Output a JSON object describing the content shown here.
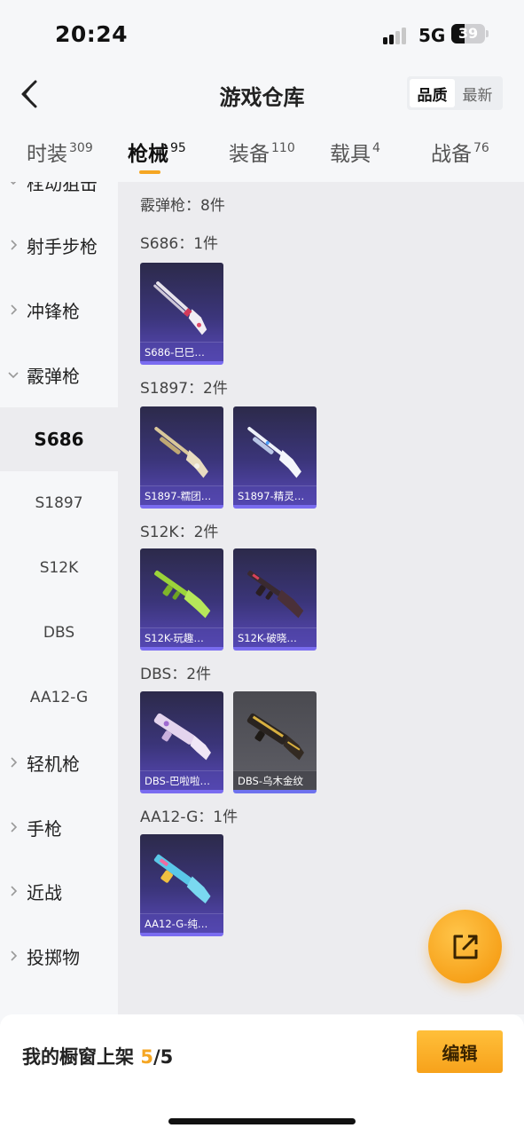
{
  "status_bar": {
    "time": "20:24",
    "network": "5G",
    "battery": "39",
    "battery_level": 0.39
  },
  "header": {
    "title": "游戏仓库",
    "sort_options": [
      "品质",
      "最新"
    ],
    "active_sort": "品质"
  },
  "tabs": [
    {
      "label": "时装",
      "count": "309"
    },
    {
      "label": "枪械",
      "count": "95",
      "active": true
    },
    {
      "label": "装备",
      "count": "110"
    },
    {
      "label": "载具",
      "count": "4"
    },
    {
      "label": "战备",
      "count": "76"
    }
  ],
  "sidebar": {
    "partial_top": "栓动狙击",
    "categories": [
      {
        "label": "射手步枪"
      },
      {
        "label": "冲锋枪"
      },
      {
        "label": "霰弹枪",
        "expanded": true
      }
    ],
    "subitems": [
      {
        "label": "S686",
        "active": true
      },
      {
        "label": "S1897"
      },
      {
        "label": "S12K"
      },
      {
        "label": "DBS"
      },
      {
        "label": "AA12-G"
      }
    ],
    "more_categories": [
      {
        "label": "轻机枪"
      },
      {
        "label": "手枪"
      },
      {
        "label": "近战"
      },
      {
        "label": "投掷物"
      }
    ]
  },
  "content": {
    "section_title": "霰弹枪：8件",
    "groups": [
      {
        "title": "S686：1件",
        "items": [
          {
            "label": "S686-巳巳…"
          }
        ]
      },
      {
        "title": "S1897：2件",
        "items": [
          {
            "label": "S1897-糯团…"
          },
          {
            "label": "S1897-精灵…"
          }
        ]
      },
      {
        "title": "S12K：2件",
        "items": [
          {
            "label": "S12K-玩趣…"
          },
          {
            "label": "S12K-破晓…"
          }
        ]
      },
      {
        "title": "DBS：2件",
        "items": [
          {
            "label": "DBS-巴啦啦…"
          },
          {
            "label": "DBS-乌木金纹"
          }
        ]
      },
      {
        "title": "AA12-G：1件",
        "items": [
          {
            "label": "AA12-G-纯…"
          }
        ]
      }
    ]
  },
  "bottom_bar": {
    "showcase_label": "我的橱窗上架",
    "showcase_current": "5",
    "showcase_total": "/5",
    "edit_label": "编辑"
  }
}
